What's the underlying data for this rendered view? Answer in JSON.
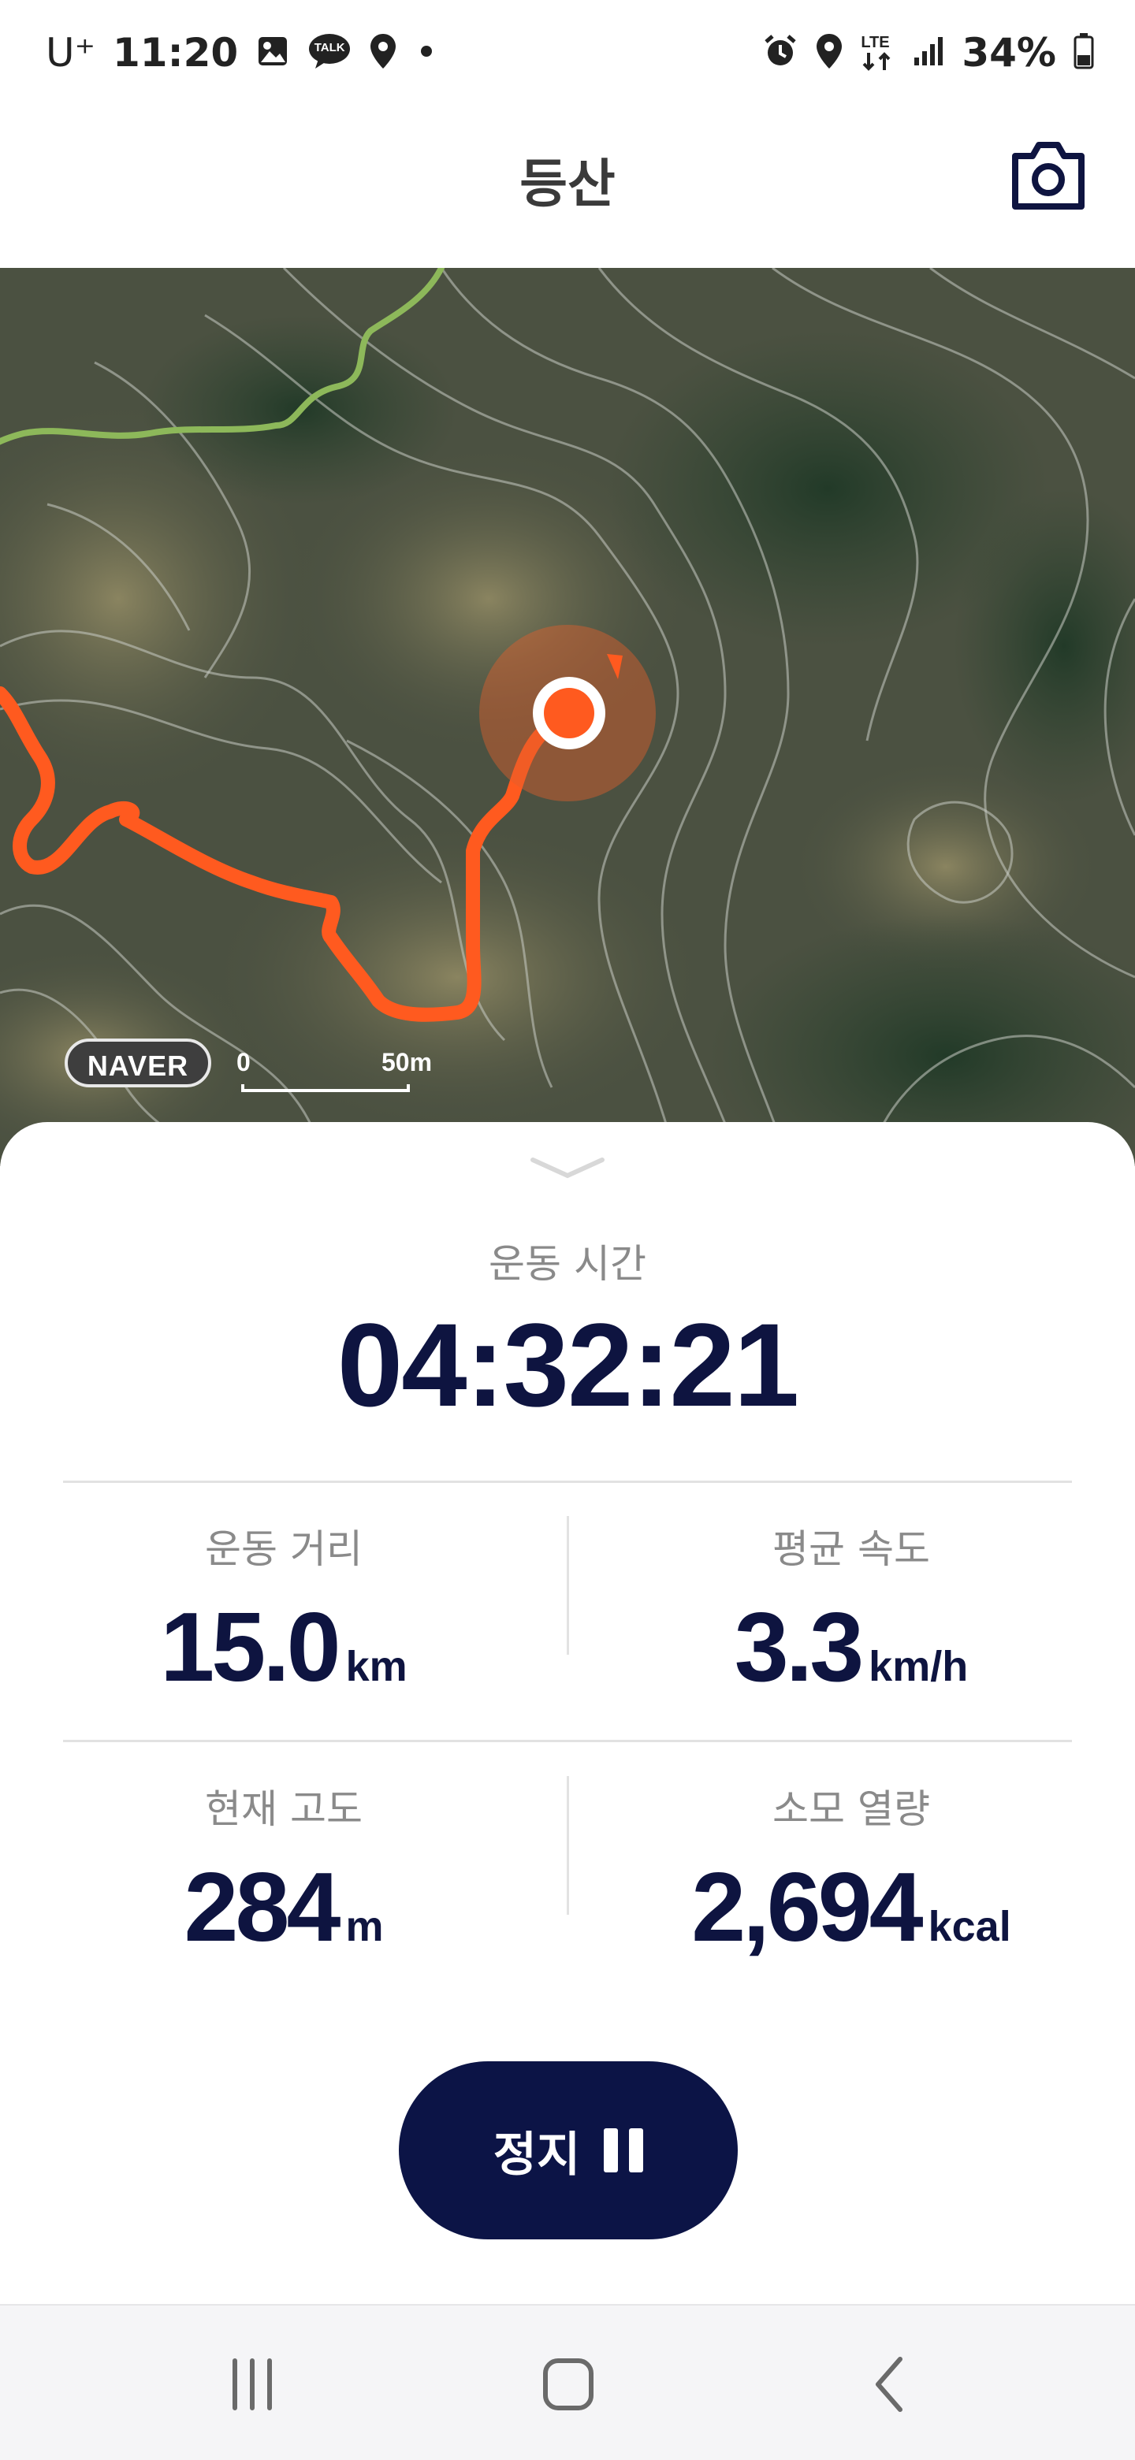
{
  "status_bar": {
    "carrier": "U⁺",
    "time": "11:20",
    "battery": "34%",
    "left_icons": [
      "gallery-icon",
      "kakaotalk-icon",
      "location-icon",
      "dot-icon"
    ],
    "right_icons": [
      "alarm-icon",
      "location-icon",
      "lte-icon",
      "signal-icon",
      "battery-icon"
    ],
    "kakao_badge": "TALK",
    "lte_label": "LTE"
  },
  "header": {
    "title": "등산",
    "camera_icon": "camera-icon"
  },
  "map": {
    "provider_badge": "NAVER",
    "scale_start": "0",
    "scale_end": "50m",
    "route_color": "#ff5a1f",
    "trail_color": "#8db85a"
  },
  "workout": {
    "time_label": "운동 시간",
    "time_value": "04:32:21",
    "stats": [
      {
        "label": "운동 거리",
        "value": "15.0",
        "unit": "km"
      },
      {
        "label": "평균 속도",
        "value": "3.3",
        "unit": "km/h"
      },
      {
        "label": "현재 고도",
        "value": "284",
        "unit": "m"
      },
      {
        "label": "소모 열량",
        "value": "2,694",
        "unit": "kcal"
      }
    ],
    "stop_label": "정지"
  },
  "colors": {
    "accent_navy": "#0c1446",
    "label_gray": "#8a8a8a"
  },
  "navigation": {
    "buttons": [
      "recent-apps-icon",
      "home-icon",
      "back-icon"
    ]
  }
}
